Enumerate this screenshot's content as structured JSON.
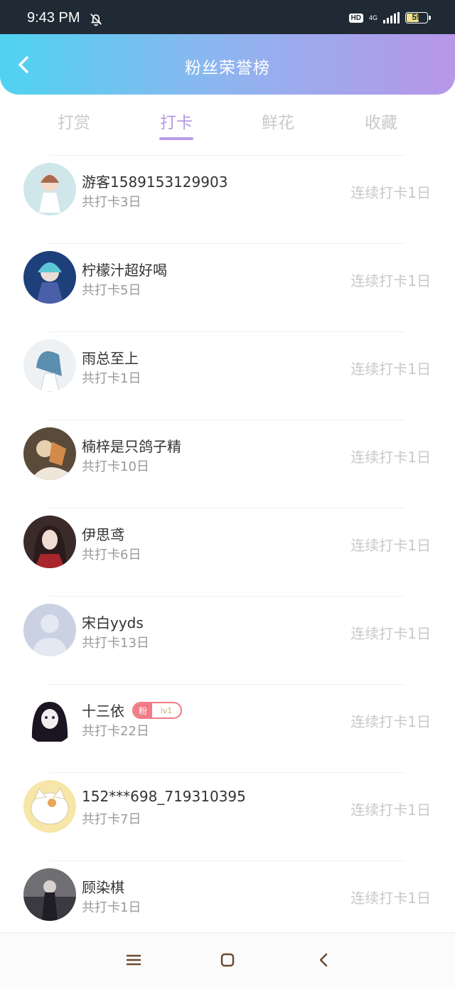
{
  "status_bar": {
    "time": "9:43 PM",
    "hd": "HD",
    "network": "4G",
    "battery": "59"
  },
  "header": {
    "title": "粉丝荣誉榜"
  },
  "tabs": [
    {
      "label": "打赏",
      "active": false
    },
    {
      "label": "打卡",
      "active": true
    },
    {
      "label": "鲜花",
      "active": false
    },
    {
      "label": "收藏",
      "active": false
    }
  ],
  "colors": {
    "accent": "#b79be6",
    "header_start": "#4fd3f0",
    "header_end": "#b896e8",
    "badge": "#f07c86"
  },
  "fans": [
    {
      "name": "游客1589153129903",
      "total": "共打卡3日",
      "streak": "连续打卡1日"
    },
    {
      "name": "柠檬汁超好喝",
      "total": "共打卡5日",
      "streak": "连续打卡1日"
    },
    {
      "name": "雨总至上",
      "total": "共打卡1日",
      "streak": "连续打卡1日"
    },
    {
      "name": "楠梓是只鸽子精",
      "total": "共打卡10日",
      "streak": "连续打卡1日"
    },
    {
      "name": "伊思鸢",
      "total": "共打卡6日",
      "streak": "连续打卡1日"
    },
    {
      "name": "宋白yyds",
      "total": "共打卡13日",
      "streak": "连续打卡1日"
    },
    {
      "name": "十三依",
      "total": "共打卡22日",
      "streak": "连续打卡1日",
      "badge_text": "粉",
      "badge_level": "lv1"
    },
    {
      "name": "152***698_719310395",
      "total": "共打卡7日",
      "streak": "连续打卡1日"
    },
    {
      "name": "顾染棋",
      "total": "共打卡1日",
      "streak": "连续打卡1日"
    }
  ],
  "icons": [
    "back-arrow-icon",
    "bell-off-icon",
    "signal-icon",
    "battery-icon",
    "menu-icon",
    "home-square-icon",
    "back-triangle-icon"
  ]
}
